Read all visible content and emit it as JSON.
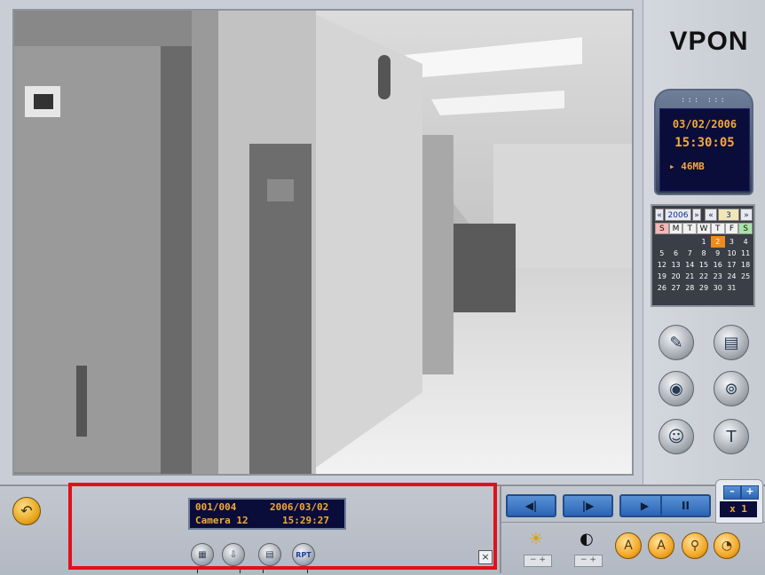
{
  "brand": {
    "logo": "VPON"
  },
  "clock": {
    "dots": "::: :::",
    "date": "03/02/2006",
    "time": "15:30:05",
    "size": "▸ 46MB"
  },
  "calendar": {
    "year": "2006",
    "month": "3",
    "prev_year": "«",
    "next_year": "»",
    "prev_month": "«",
    "next_month": "»",
    "weekdays": [
      "S",
      "M",
      "T",
      "W",
      "T",
      "F",
      "S"
    ],
    "selected_day": "2",
    "weeks": [
      [
        "",
        "",
        "",
        "",
        "1",
        "2",
        "3",
        "4"
      ],
      [
        "5",
        "6",
        "7",
        "8",
        "9",
        "10",
        "11"
      ],
      [
        "12",
        "13",
        "14",
        "15",
        "16",
        "17",
        "18"
      ],
      [
        "19",
        "20",
        "21",
        "22",
        "23",
        "24",
        "25"
      ],
      [
        "26",
        "27",
        "28",
        "29",
        "30",
        "31",
        ""
      ]
    ]
  },
  "side_buttons": [
    {
      "icon": "edit-icon"
    },
    {
      "icon": "note-icon"
    },
    {
      "icon": "disk-icon"
    },
    {
      "icon": "film-icon"
    },
    {
      "icon": "user-icon"
    },
    {
      "icon": "text-icon"
    }
  ],
  "info": {
    "channel": "001/004",
    "date": "2006/03/02",
    "camera": "Camera 12",
    "time": "15:29:27"
  },
  "small_buttons": [
    {
      "icon": "doc-icon",
      "label": ""
    },
    {
      "icon": "export-icon",
      "label": ""
    },
    {
      "icon": "list-icon",
      "label": ""
    },
    {
      "icon": "report-icon",
      "label": "RPT"
    }
  ],
  "close_label": "×",
  "playback": [
    {
      "label": "◀|"
    },
    {
      "label": "|▶"
    },
    {
      "label": "▶"
    },
    {
      "label": "II"
    }
  ],
  "zoom": {
    "minus": "–",
    "plus": "+",
    "level": "x 1"
  },
  "adjust": [
    {
      "icon": "☀",
      "pm": "− +"
    },
    {
      "icon": "◐",
      "pm": "− +"
    }
  ],
  "orange_buttons": [
    {
      "icon": "A"
    },
    {
      "icon": "A"
    },
    {
      "icon": "⚲"
    },
    {
      "icon": "◔"
    }
  ],
  "colors": {
    "accent": "#f2a93b",
    "highlight": "#e0111b",
    "screen": "#0a0d3a"
  }
}
